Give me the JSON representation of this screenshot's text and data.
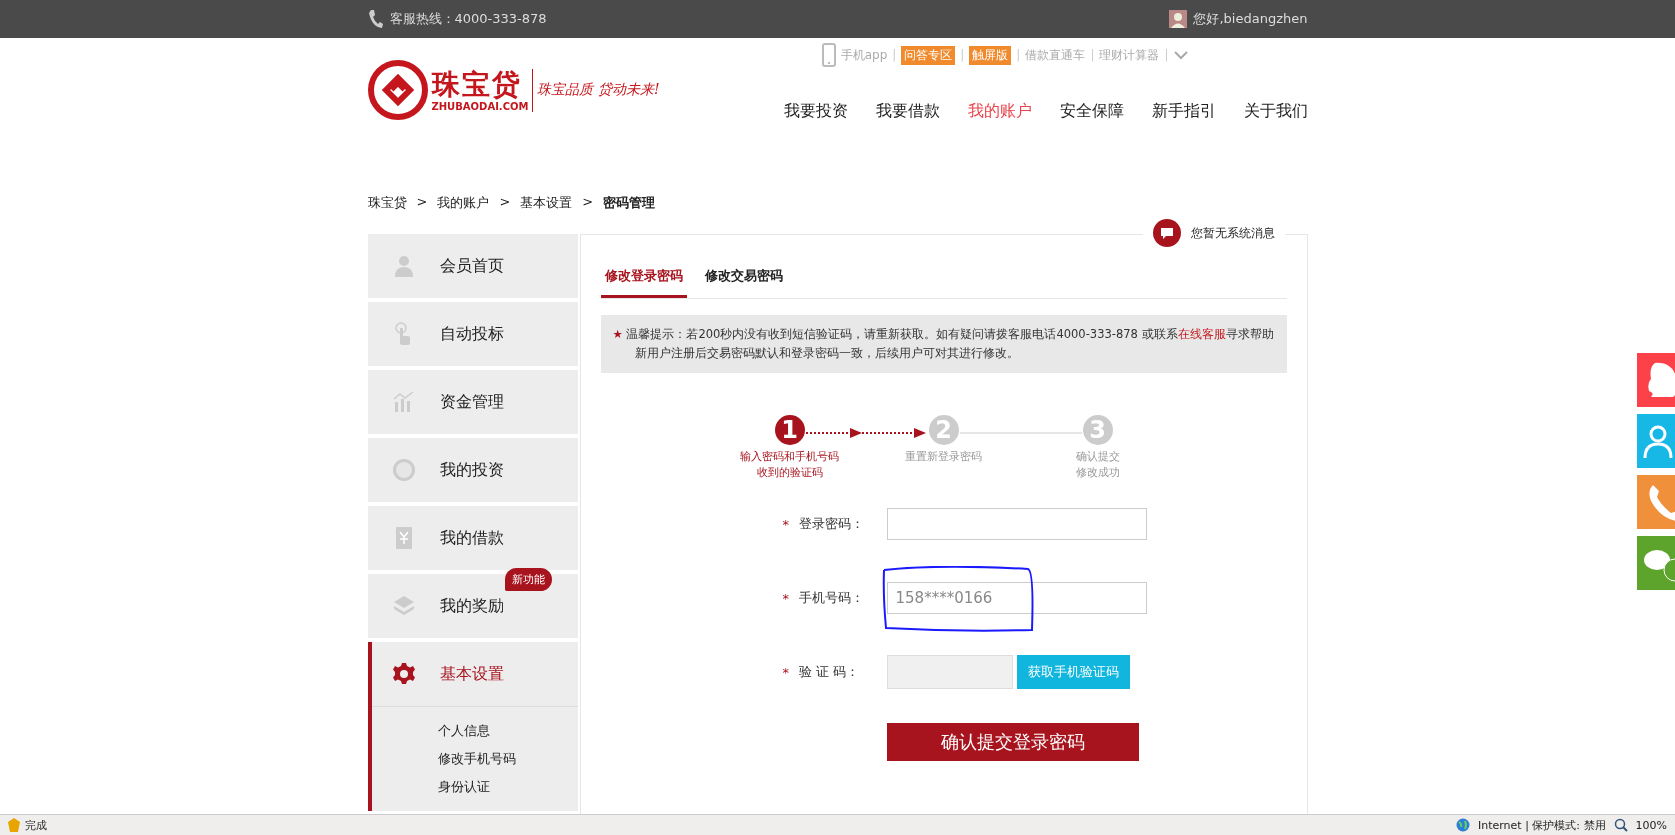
{
  "top_bar": {
    "hotline": "客服热线：4000-333-878",
    "greeting": "您好,biedangzhen"
  },
  "logo": {
    "name": "珠宝贷",
    "domain": "ZHUBAODAI.COM",
    "slogan": "珠宝品质 贷动未来!"
  },
  "quick_links": [
    {
      "label": "手机app",
      "highlighted": false
    },
    {
      "sep": "|",
      "label": "问答专区",
      "highlighted": true
    },
    {
      "sep": "|",
      "label": "触屏版",
      "highlighted": true
    },
    {
      "sep": "|",
      "label": "借款直通车",
      "highlighted": false
    },
    {
      "sep": "|",
      "label": "理财计算器",
      "highlighted": false
    }
  ],
  "quick_links_end_sep": "|",
  "nav": [
    {
      "label": "我要投资",
      "selected": false
    },
    {
      "label": "我要借款",
      "selected": false
    },
    {
      "label": "我的账户",
      "selected": true
    },
    {
      "label": "安全保障",
      "selected": false
    },
    {
      "label": "新手指引",
      "selected": false
    },
    {
      "label": "关于我们",
      "selected": false
    }
  ],
  "breadcrumb": [
    {
      "label": "珠宝贷",
      "current": false
    },
    {
      "sep": ">",
      "label": "我的账户",
      "current": false
    },
    {
      "sep": ">",
      "label": "基本设置",
      "current": false
    },
    {
      "sep": ">",
      "label": "密码管理",
      "current": true
    }
  ],
  "sidebar": {
    "items": [
      {
        "label": "会员首页",
        "kind": "person",
        "selected": false
      },
      {
        "label": "自动投标",
        "kind": "hand",
        "selected": false
      },
      {
        "label": "资金管理",
        "kind": "chart",
        "selected": false
      },
      {
        "label": "我的投资",
        "kind": "coin",
        "selected": false
      },
      {
        "label": "我的借款",
        "kind": "note",
        "selected": false
      },
      {
        "label": "我的奖励",
        "kind": "layers",
        "selected": false,
        "badge": "新功能"
      },
      {
        "label": "基本设置",
        "kind": "gear",
        "selected": true
      }
    ],
    "sub_items": [
      "个人信息",
      "修改手机号码",
      "身份认证"
    ]
  },
  "notice": "您暂无系统消息",
  "tabs": [
    {
      "label": "修改登录密码",
      "selected": true
    },
    {
      "label": "修改交易密码",
      "selected": false
    }
  ],
  "tip": {
    "mark": "★",
    "before": "温馨提示：若200秒内没有收到短信验证码，请重新获取。如有疑问请拨客服电话4000-333-878 或联系",
    "link": "在线客服",
    "after": "寻求帮助",
    "note": "新用户注册后交易密码默认和登录密码一致，后续用户可对其进行修改。"
  },
  "steps": [
    {
      "number": "1",
      "lines": [
        "输入密码和手机号码",
        "收到的验证码"
      ],
      "active": true
    },
    {
      "number": "2",
      "lines": [
        "重置新登录密码"
      ],
      "active": false
    },
    {
      "number": "3",
      "lines": [
        "确认提交",
        "修改成功"
      ],
      "active": false
    }
  ],
  "form": [
    {
      "kind": "input",
      "required": "*",
      "label": "登录密码："
    },
    {
      "kind": "input",
      "required": "*",
      "label": "手机号码：",
      "value": "158****0166"
    },
    {
      "kind": "code",
      "required": "*",
      "label": "验 证 码：",
      "button": "获取手机验证码"
    }
  ],
  "submit": "确认提交登录密码",
  "side_buttons": [
    {
      "kind": "penguin",
      "color": "#fd4149"
    },
    {
      "kind": "people",
      "color": "#17b8e6"
    },
    {
      "kind": "phone",
      "color": "#f0903a"
    },
    {
      "kind": "chat",
      "color": "#5ca42b"
    }
  ],
  "status_bar": {
    "status": "完成",
    "zone": "Internet | 保护模式: 禁用",
    "zoom": "100%"
  }
}
